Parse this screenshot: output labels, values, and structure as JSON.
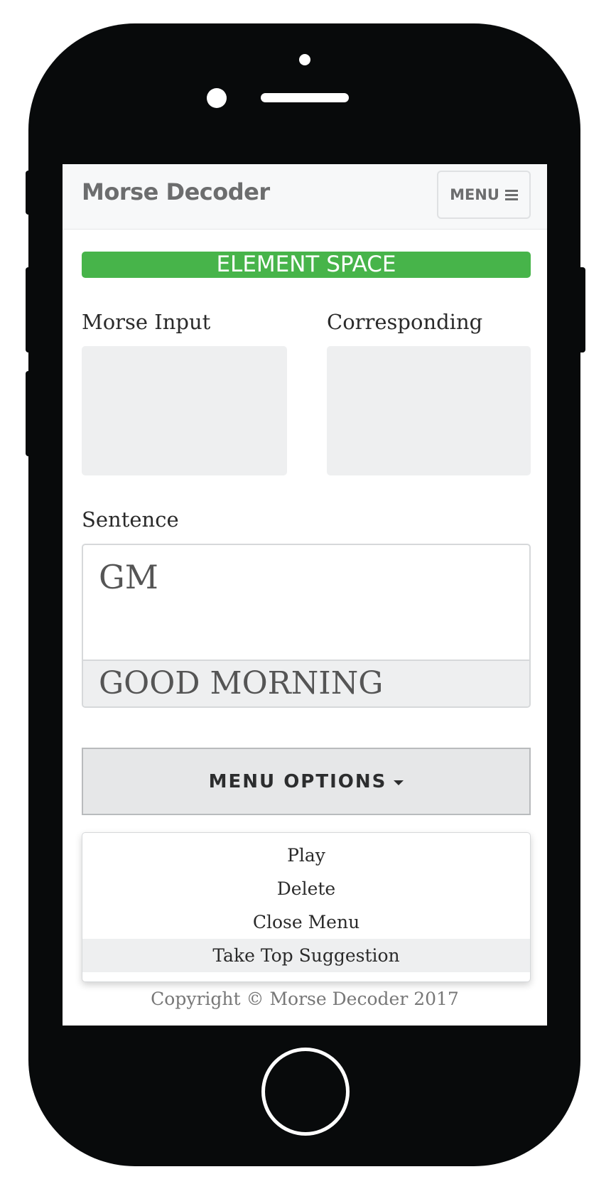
{
  "navbar": {
    "brand": "Morse Decoder",
    "menu_label": "MENU"
  },
  "status_banner": "ELEMENT SPACE",
  "inputs": {
    "morse_label": "Morse Input",
    "corresponding_label": "Corresponding",
    "morse_value": "",
    "corresponding_value": ""
  },
  "sentence": {
    "label": "Sentence",
    "value": "GM",
    "suggestion": "GOOD MORNING"
  },
  "menu_options": {
    "label": "MENU OPTIONS",
    "items": [
      {
        "label": "Play"
      },
      {
        "label": "Delete"
      },
      {
        "label": "Close Menu"
      },
      {
        "label": "Take Top Suggestion"
      }
    ],
    "highlighted_index": 3
  },
  "footer": {
    "copyright": "Copyright © Morse Decoder 2017"
  },
  "colors": {
    "banner": "#47b44a",
    "phone_body": "#080a0b",
    "field_bg": "#eeeff0"
  }
}
